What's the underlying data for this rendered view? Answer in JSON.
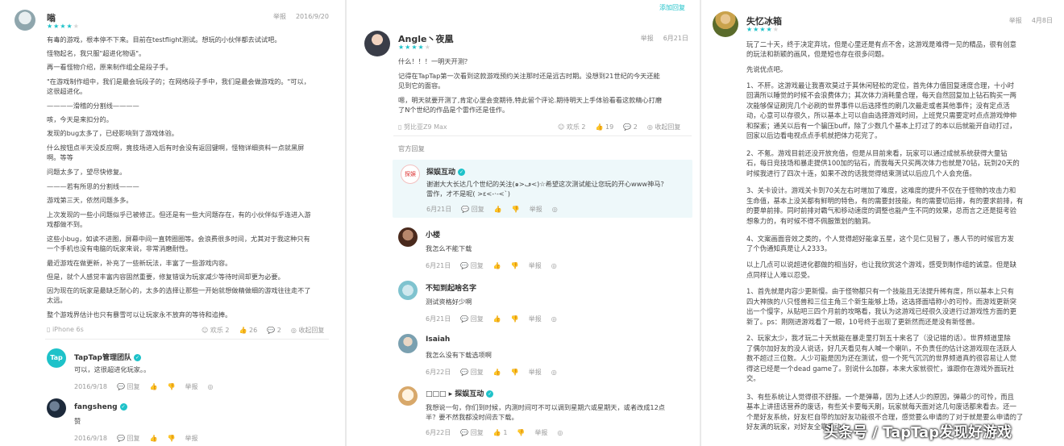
{
  "col1": {
    "user": "嗡",
    "rating": 4,
    "report": "举报",
    "date": "2016/9/20",
    "paragraphs": [
      "有毒的游戏，根本停不下来。目前在testflight测试。想玩的小伙伴都去试试吧。",
      "怪物起名，我只服\"超进化物语\"。",
      "再一看怪物介绍，原来制作组全是段子手。",
      "\"在游戏制作组中，我们是最会玩段子的；在网络段子手中，我们是最会做游戏的。\"可以，",
      "这很超进化。",
      "————滑稽的分割线————",
      "咳，今天是来扣分的。",
      "发现的bug太多了，已经影响到了游戏体验。",
      "什么按钮点半天没反应啊，竟技场进入后有时会没有返回键啊，怪物详细资料一点就黑屏",
      "啊。等等",
      "问题太多了，望尽快修复。",
      "———若有所思的分割线———",
      "游戏第三天，依然问题多多。",
      "上次发现的一些小问题似乎已被修正。但还是有一些大问题存在，有的小伙伴似乎连进入游",
      "戏都做不到。",
      "这些小bug，如读不进图，屏幕中间一直转圈圈等。会浪费很多时间，尤其对于我这种只有",
      "一个手机也没有电脑的玩家来说，非常消磨耐性。",
      "最近游戏在做更新，补充了一些新玩法，丰富了一些游戏内容。",
      "但是，就个人感觉丰富内容固然重要，修复错误为玩家减少等待时间却更为必要。",
      "因为现在的玩家是最缺乏耐心的，太多的选择让那些一开始就想做精做细的游戏往往走不了",
      "太远。",
      "整个游戏界估计也只有暴雪可以让玩家永不放弃的等待和追捧。"
    ],
    "device": "iPhone 6s",
    "stats": {
      "joy": "欢乐 2",
      "likes": "26",
      "replies": "2",
      "collapse": "收起回复"
    },
    "replies": [
      {
        "name": "TapTap管理团队",
        "text": "可以，这很超进化玩家。。",
        "date": "2016/9/18",
        "reply": "回复",
        "report": "举报"
      },
      {
        "name": "fangsheng",
        "text": "赞",
        "date": "2016/9/18",
        "reply": "回复",
        "report": "举报"
      }
    ]
  },
  "col2": {
    "collapse_link": "添加回复",
    "user": "Angle丶夜凰",
    "rating": 4,
    "report": "举报",
    "date": "6月21日",
    "paragraphs": [
      "什么！！！一明天开测？",
      "记得在TapTap第一次看到这款游戏预约关注那时还是远古时期。没想到21世纪的今天还能",
      "见到它的面容。",
      "嗯，明天就要开测了,肯定心里会变期待,特此留个评论.期待明天上手体验看看这款精心打磨",
      "了N个世纪的作品是个雷作还是佳作。"
    ],
    "device": "努比亚Z9 Max",
    "stats": {
      "joy": "欢乐 2",
      "likes": "19",
      "replies": "2",
      "collapse": "收起回复"
    },
    "official_label": "官方回复",
    "official": {
      "name": "探娱互动",
      "text1": "谢谢大大长达几个世纪的关注(๑>ڡ<)☆希望这次测试能让您玩的开心www神马？",
      "text2": "雷作，才不是呢( >ε<-·-<`)",
      "date": "6月21日",
      "reply": "回复",
      "report": "举报"
    },
    "replies": [
      {
        "name": "小楼",
        "text": "我怎么不能下载",
        "date": "6月21日",
        "reply": "回复",
        "report": "举报"
      },
      {
        "name": "不知到起啥名字",
        "text": "测试资格好少啊",
        "date": "6月21日",
        "reply": "回复",
        "report": "举报"
      },
      {
        "name": "Isaiah",
        "text": "我怎么没有下载选项啊",
        "date": "6月22日",
        "reply": "回复",
        "report": "举报"
      },
      {
        "name": "□□□ ▸ 探娱互动",
        "text": "我想说一句，你们到时候，内测时间可不可以调到星期六或星期天，或者改成12点",
        "text2": "半？要不然我都没时间去下载。",
        "date": "6月22日",
        "reply": "回复",
        "likes": "1",
        "report": "举报"
      }
    ]
  },
  "col3": {
    "user": "失忆冰箱",
    "rating": 4,
    "report": "举报",
    "date": "4月8日",
    "paragraphs": [
      "玩了二十天，终于决定弃坑，但是心里还是有点不舍，这游戏是难得一见的精品，很有创意",
      "的玩法和新颖的画风，但是短也存在很多问题。",
      "先说优点吧。",
      "1、不肝。这游戏最让我喜欢莫过于其休闲轻松的定位，首先体力值回复速度合理，十小时",
      "回满所以睡觉的时候不会浪费体力；其次体力消耗量合理，每天自然回复加上钻石购买一两",
      "次能够保证刷完几个必刷的世界事件以后选择性的刷几次最走或者其他事件；没有定点活",
      "动，心意可以存很久，所以基本上可以自由选择游戏时间，上班党只需要定时点点游戏伸伸",
      "和探索；通关以后有一个骗压buff，除了少数几个基本上打过了的本以后就能开自动打过，",
      "回家以后边看电视点点手机就把体力花完了。",
      "2、不氪。游戏目前还没开放充值，但是从目前来看，玩家可以通过成就系统获得大量钻",
      "石，每日竞技场和暴走提供100加的钻石，而我每天只买两次体力也就是70钻，玩到20天的",
      "时候我进行了四次十连，如果不改的话我觉得结束测试以后应几个人会充值。",
      "3、关卡设计。游戏关卡到70关左右时增加了难度，这难度的提升不仅在于怪物的攻击力和",
      "生命值，基本上没关都有鲜明的特色，有的需要封技能，有的需要切后排，有的要求前排，有",
      "的要单前排。同时前排对霸气和移动速度的调整也能产生不同的效果，总而言之还是挺考验",
      "想象力的，有时候不得不佩服策划的脑洞。",
      "4、文案画面音效之类的，个人觉得超好能拿五星，这个见仁见智了，愚人节的时候官方发",
      "了个伪通知真是让人2333。",
      "以上几点可以说超进化都做的相当好，也让我欣赏这个游戏，感受到制作组的诚意。但是缺",
      "点同样让人难以忍受。",
      "1、首先就是内容少更新慢。由于怪物都只有一个技能且无法提升稀有度，所以基本上只有",
      "四大神族的八只怪兽和三位主角三个新生能够上场，这选择面墙称小的可怜。而游戏更新突",
      "出一个慢字，从贴吧三四个月前的攻略看，我认为这游戏已经很久没进行过游戏性方面的更",
      "新了。ps：刚刚进游戏看了一眼，10号终于出现了更新然而还是没有新怪兽。",
      "2、玩家太少，我才玩二十天就能在暴走里打到五十来名了（没记错的话）。世界频道里除",
      "了偶尔加好友的没人说话，好几天看见有人喊一个喇叭，不负责任的估计这游戏现在活跃人",
      "数不超过三位数。人少可能是因为还在测试，但一个死气沉沉的世界频道真的很容易让人觉",
      "得这已经是一个dead game了。别说什么加群，本来大家就很忙，谁跟你在游戏外面玩社",
      "交。",
      "3、有些系统让人觉得很不舒服。一个是弹幕，因为上述人少的原因，弹幕少的可怜，而且",
      "基本上讲扭话营养的废话，有些关卡要每天刷，玩家就每天面对这几句废话都来看去。还一",
      "个是好友系统，好友栏自带的加好友功能很不合理，感觉要么申请的了对于就是要么申请的了",
      "好友满的玩家，对好友全靠手动..."
    ]
  },
  "watermark": "头条号 / TapTap发现好游戏"
}
